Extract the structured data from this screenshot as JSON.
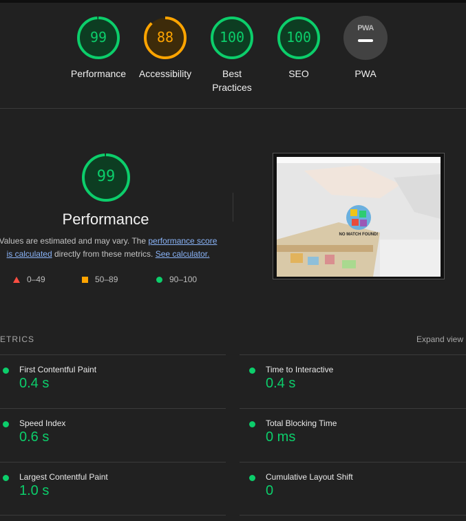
{
  "gauges": [
    {
      "label": "Performance",
      "score": "99",
      "status": "pass"
    },
    {
      "label": "Accessibility",
      "score": "88",
      "status": "average"
    },
    {
      "label": "Best Practices",
      "score": "100",
      "status": "pass"
    },
    {
      "label": "SEO",
      "score": "100",
      "status": "pass"
    },
    {
      "label": "PWA",
      "badge": "PWA",
      "status": "not-applicable"
    }
  ],
  "performance": {
    "score": "99",
    "title": "Performance",
    "desc_prefix": "Values are estimated and may vary. The ",
    "link_score": "performance score is calculated",
    "desc_mid": " directly from these metrics. ",
    "link_calc": "See calculator."
  },
  "legend": [
    {
      "icon": "triangle-icon",
      "range": "0–49",
      "color": "#ff4e42"
    },
    {
      "icon": "square-icon",
      "range": "50–89",
      "color": "#ffa400"
    },
    {
      "icon": "circle-icon",
      "range": "90–100",
      "color": "#0cce6b"
    }
  ],
  "screenshot": {
    "overlay_text": "NO MATCH FOUND!"
  },
  "metrics": {
    "heading": "ETRICS",
    "expand_label": "Expand view",
    "items": [
      {
        "name": "First Contentful Paint",
        "value": "0.4 s"
      },
      {
        "name": "Time to Interactive",
        "value": "0.4 s"
      },
      {
        "name": "Speed Index",
        "value": "0.6 s"
      },
      {
        "name": "Total Blocking Time",
        "value": "0 ms"
      },
      {
        "name": "Largest Contentful Paint",
        "value": "1.0 s"
      },
      {
        "name": "Cumulative Layout Shift",
        "value": "0"
      }
    ]
  },
  "colors": {
    "pass": "#0cce6b",
    "average": "#ffa400",
    "fail": "#ff4e42",
    "background": "#212121"
  }
}
